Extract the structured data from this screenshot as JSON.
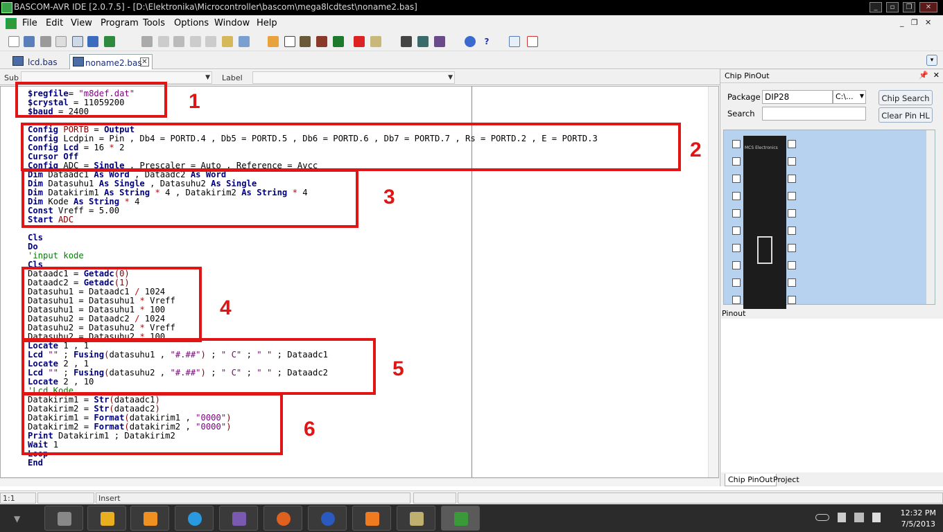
{
  "window": {
    "title": "BASCOM-AVR IDE [2.0.7.5] - [D:\\Elektronika\\Microcontroller\\bascom\\mega8lcdtest\\noname2.bas]"
  },
  "menu": [
    "File",
    "Edit",
    "View",
    "Program",
    "Tools",
    "Options",
    "Window",
    "Help"
  ],
  "tabs": [
    {
      "label": "lcd.bas"
    },
    {
      "label": "noname2.bas"
    }
  ],
  "subbar": {
    "sub_label": "Sub",
    "label_label": "Label"
  },
  "code_lines": [
    [
      [
        "k",
        "$regfile"
      ],
      [
        "",
        ""
      ],
      [
        "",
        "= "
      ],
      [
        "s",
        "\"m8def.dat\""
      ]
    ],
    [
      [
        "k",
        "$crystal"
      ],
      [
        "",
        " = 11059200"
      ]
    ],
    [
      [
        "k",
        "$baud"
      ],
      [
        "",
        " = 2400"
      ]
    ],
    [
      [
        "",
        ""
      ]
    ],
    [
      [
        "k",
        "Config"
      ],
      [
        "",
        " "
      ],
      [
        "par",
        "PORTB"
      ],
      [
        "",
        " = "
      ],
      [
        "k",
        "Output"
      ]
    ],
    [
      [
        "k",
        "Config"
      ],
      [
        "",
        " Lcdpin = Pin , Db4 = PORTD.4 , Db5 = PORTD.5 , Db6 = PORTD.6 , Db7 = PORTD.7 , Rs = PORTD.2 , E = PORTD.3"
      ]
    ],
    [
      [
        "k",
        "Config Lcd"
      ],
      [
        "",
        " = 16 "
      ],
      [
        "op",
        "*"
      ],
      [
        "",
        " 2"
      ]
    ],
    [
      [
        "k",
        "Cursor Off"
      ]
    ],
    [
      [
        "k",
        "Config"
      ],
      [
        "",
        " ADC = "
      ],
      [
        "k",
        "Single"
      ],
      [
        "",
        " , Prescaler = Auto , Reference = Avcc"
      ]
    ],
    [
      [
        "k",
        "Dim"
      ],
      [
        "",
        " Dataadc1 "
      ],
      [
        "k",
        "As Word"
      ],
      [
        "",
        " , Dataadc2 "
      ],
      [
        "k",
        "As Word"
      ]
    ],
    [
      [
        "k",
        "Dim"
      ],
      [
        "",
        " Datasuhu1 "
      ],
      [
        "k",
        "As Single"
      ],
      [
        "",
        " , Datasuhu2 "
      ],
      [
        "k",
        "As Single"
      ]
    ],
    [
      [
        "k",
        "Dim"
      ],
      [
        "",
        " Datakirim1 "
      ],
      [
        "k",
        "As String"
      ],
      [
        "",
        " "
      ],
      [
        "op",
        "*"
      ],
      [
        "",
        " 4 , Datakirim2 "
      ],
      [
        "k",
        "As String"
      ],
      [
        "",
        " "
      ],
      [
        "op",
        "*"
      ],
      [
        "",
        " 4"
      ]
    ],
    [
      [
        "k",
        "Dim"
      ],
      [
        "",
        " Kode "
      ],
      [
        "k",
        "As String"
      ],
      [
        "",
        " "
      ],
      [
        "op",
        "*"
      ],
      [
        "",
        " 4"
      ]
    ],
    [
      [
        "k",
        "Const"
      ],
      [
        "",
        " Vreff = 5.00"
      ]
    ],
    [
      [
        "k",
        "Start"
      ],
      [
        "",
        " "
      ],
      [
        "par",
        "ADC"
      ]
    ],
    [
      [
        "",
        ""
      ]
    ],
    [
      [
        "k",
        "Cls"
      ]
    ],
    [
      [
        "k",
        "Do"
      ]
    ],
    [
      [
        "c",
        "'input kode"
      ]
    ],
    [
      [
        "k",
        "Cls"
      ]
    ],
    [
      [
        "",
        "Dataadc1 = "
      ],
      [
        "k",
        "Getadc"
      ],
      [
        "par",
        "(0)"
      ]
    ],
    [
      [
        "",
        "Dataadc2 = "
      ],
      [
        "k",
        "Getadc"
      ],
      [
        "par",
        "(1)"
      ]
    ],
    [
      [
        "",
        "Datasuhu1 = Dataadc1 "
      ],
      [
        "op",
        "/"
      ],
      [
        "",
        " 1024"
      ]
    ],
    [
      [
        "",
        "Datasuhu1 = Datasuhu1 "
      ],
      [
        "op",
        "*"
      ],
      [
        "",
        " Vreff"
      ]
    ],
    [
      [
        "",
        "Datasuhu1 = Datasuhu1 "
      ],
      [
        "op",
        "*"
      ],
      [
        "",
        " 100"
      ]
    ],
    [
      [
        "",
        "Datasuhu2 = Dataadc2 "
      ],
      [
        "op",
        "/"
      ],
      [
        "",
        " 1024"
      ]
    ],
    [
      [
        "",
        "Datasuhu2 = Datasuhu2 "
      ],
      [
        "op",
        "*"
      ],
      [
        "",
        " Vreff"
      ]
    ],
    [
      [
        "",
        "Datasuhu2 = Datasuhu2 "
      ],
      [
        "op",
        "*"
      ],
      [
        "",
        " 100"
      ]
    ],
    [
      [
        "k",
        "Locate"
      ],
      [
        "",
        " 1 , 1"
      ]
    ],
    [
      [
        "k",
        "Lcd"
      ],
      [
        "",
        " "
      ],
      [
        "s",
        "\"\""
      ],
      [
        "",
        " ; "
      ],
      [
        "k",
        "Fusing"
      ],
      [
        "par",
        "("
      ],
      [
        "",
        "datasuhu1 , "
      ],
      [
        "s",
        "\"#.##\""
      ],
      [
        "par",
        ")"
      ],
      [
        "",
        " ; "
      ],
      [
        "s",
        "\" C\""
      ],
      [
        "",
        " ; "
      ],
      [
        "s",
        "\" \""
      ],
      [
        "",
        " ; Dataadc1"
      ]
    ],
    [
      [
        "k",
        "Locate"
      ],
      [
        "",
        " 2 , 1"
      ]
    ],
    [
      [
        "k",
        "Lcd"
      ],
      [
        "",
        " "
      ],
      [
        "s",
        "\"\""
      ],
      [
        "",
        " ; "
      ],
      [
        "k",
        "Fusing"
      ],
      [
        "par",
        "("
      ],
      [
        "",
        "datasuhu2 , "
      ],
      [
        "s",
        "\"#.##\""
      ],
      [
        "par",
        ")"
      ],
      [
        "",
        " ; "
      ],
      [
        "s",
        "\" C\""
      ],
      [
        "",
        " ; "
      ],
      [
        "s",
        "\" \""
      ],
      [
        "",
        " ; Dataadc2"
      ]
    ],
    [
      [
        "k",
        "Locate"
      ],
      [
        "",
        " 2 , 10"
      ]
    ],
    [
      [
        "c",
        "'Lcd Kode"
      ]
    ],
    [
      [
        "",
        "Datakirim1 = "
      ],
      [
        "k",
        "Str"
      ],
      [
        "par",
        "("
      ],
      [
        "",
        "dataadc1"
      ],
      [
        "par",
        ")"
      ]
    ],
    [
      [
        "",
        "Datakirim2 = "
      ],
      [
        "k",
        "Str"
      ],
      [
        "par",
        "("
      ],
      [
        "",
        "dataadc2"
      ],
      [
        "par",
        ")"
      ]
    ],
    [
      [
        "",
        "Datakirim1 = "
      ],
      [
        "k",
        "Format"
      ],
      [
        "par",
        "("
      ],
      [
        "",
        "datakirim1 , "
      ],
      [
        "s",
        "\"0000\""
      ],
      [
        "par",
        ")"
      ]
    ],
    [
      [
        "",
        "Datakirim2 = "
      ],
      [
        "k",
        "Format"
      ],
      [
        "par",
        "("
      ],
      [
        "",
        "datakirim2 , "
      ],
      [
        "s",
        "\"0000\""
      ],
      [
        "par",
        ")"
      ]
    ],
    [
      [
        "k",
        "Print"
      ],
      [
        "",
        " Datakirim1 ; Datakirim2"
      ]
    ],
    [
      [
        "k",
        "Wait"
      ],
      [
        "",
        " 1"
      ]
    ],
    [
      [
        "k",
        "Loop"
      ]
    ],
    [
      [
        "k",
        "End"
      ]
    ]
  ],
  "annotations": [
    "1",
    "2",
    "3",
    "4",
    "5",
    "6"
  ],
  "chip_pinout": {
    "title": "Chip PinOut",
    "package_label": "Package",
    "package_value": "DIP28",
    "path_value": "C:\\...",
    "search_label": "Search",
    "chip_search_button": "Chip Search",
    "clear_pin_button": "Clear Pin HL",
    "chip_caption": "MCS Electronics",
    "pinout_label": "Pinout",
    "bottom_tabs": [
      "Chip PinOut",
      "Project"
    ]
  },
  "status": {
    "position": "1:1",
    "mode": "Insert"
  },
  "clock": {
    "time": "12:32 PM",
    "date": "7/5/2013"
  },
  "colors": {
    "annotation_red": "#e01616",
    "keyword": "#00007f",
    "string": "#7f007f",
    "comment": "#007f00"
  }
}
